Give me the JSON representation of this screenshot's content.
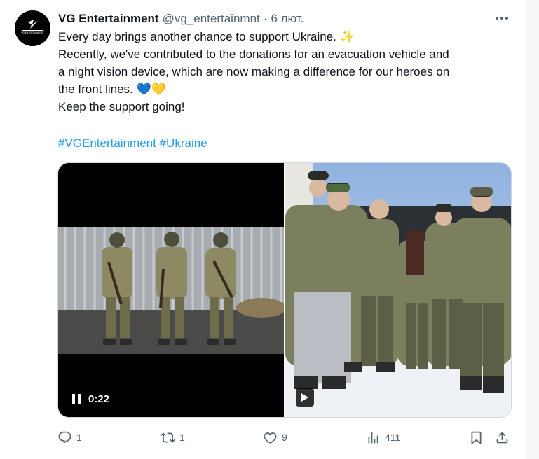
{
  "author": {
    "name": "VG Entertainment",
    "handle": "@vg_entertainmnt",
    "time": "6 лют.",
    "avatar_text": "VG ENTERTAINMENT"
  },
  "tweet": {
    "line1": "Every day brings another chance to support Ukraine. ✨",
    "line2": "Recently, we've contributed to the donations for an evacuation vehicle and",
    "line3": "a night vision device, which are now making a difference for our heroes on",
    "line4": "the front lines. 💙💛",
    "line5": "Keep the support going!",
    "hashtags": [
      "#VGEntertainment",
      "#Ukraine"
    ]
  },
  "media": {
    "video_time": "0:22"
  },
  "actions": {
    "replies": "1",
    "retweets": "1",
    "likes": "9",
    "views": "411"
  },
  "colors": {
    "link": "#1d9bf0",
    "secondary_text": "#536471",
    "border": "#cfd9de"
  }
}
